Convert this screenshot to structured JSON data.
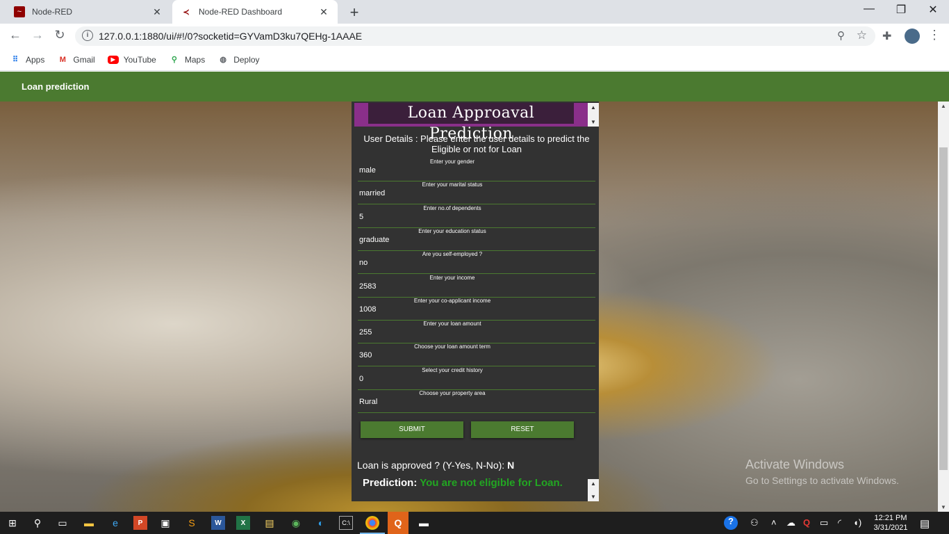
{
  "browser": {
    "tabs": [
      {
        "title": "Node-RED",
        "active": false
      },
      {
        "title": "Node-RED Dashboard",
        "active": true
      }
    ],
    "url": "127.0.0.1:1880/ui/#!/0?socketid=GYVamD3ku7QEHg-1AAAE",
    "bookmarks": [
      {
        "label": "Apps",
        "icon": "apps-grid-icon"
      },
      {
        "label": "Gmail",
        "icon": "gmail-icon"
      },
      {
        "label": "YouTube",
        "icon": "youtube-icon"
      },
      {
        "label": "Maps",
        "icon": "maps-icon"
      },
      {
        "label": "Deploy",
        "icon": "globe-icon"
      }
    ]
  },
  "dashboard": {
    "title": "Loan prediction"
  },
  "card": {
    "heading": "Loan Approaval Prediction",
    "intro": "User Details : Please enter the user details to predict the Eligible or not for Loan",
    "fields": [
      {
        "label": "Enter your gender",
        "value": "male"
      },
      {
        "label": "Enter your marital status",
        "value": "married"
      },
      {
        "label": "Enter no.of dependents",
        "value": "5"
      },
      {
        "label": "Enter your education status",
        "value": "graduate"
      },
      {
        "label": "Are you self-employed ?",
        "value": "no"
      },
      {
        "label": "Enter your income",
        "value": "2583"
      },
      {
        "label": "Enter your co-applicant income",
        "value": "1008"
      },
      {
        "label": "Enter your loan amount",
        "value": "255"
      },
      {
        "label": "Choose your loan amount term",
        "value": "360"
      },
      {
        "label": "Select your credit history",
        "value": "0"
      },
      {
        "label": "Choose your property area",
        "value": "Rural"
      }
    ],
    "submit_label": "SUBMIT",
    "reset_label": "RESET",
    "approved_label": "Loan is approved ? (Y-Yes, N-No):",
    "approved_value": "N",
    "prediction_label": "Prediction:",
    "prediction_message": "You are not eligible for Loan."
  },
  "watermark": {
    "line1": "Activate Windows",
    "line2": "Go to Settings to activate Windows."
  },
  "taskbar": {
    "time": "12:21 PM",
    "date": "3/31/2021"
  },
  "colors": {
    "header_green": "#4b7a30",
    "title_purple": "#8a2f8a",
    "prediction_green": "#22a622"
  }
}
